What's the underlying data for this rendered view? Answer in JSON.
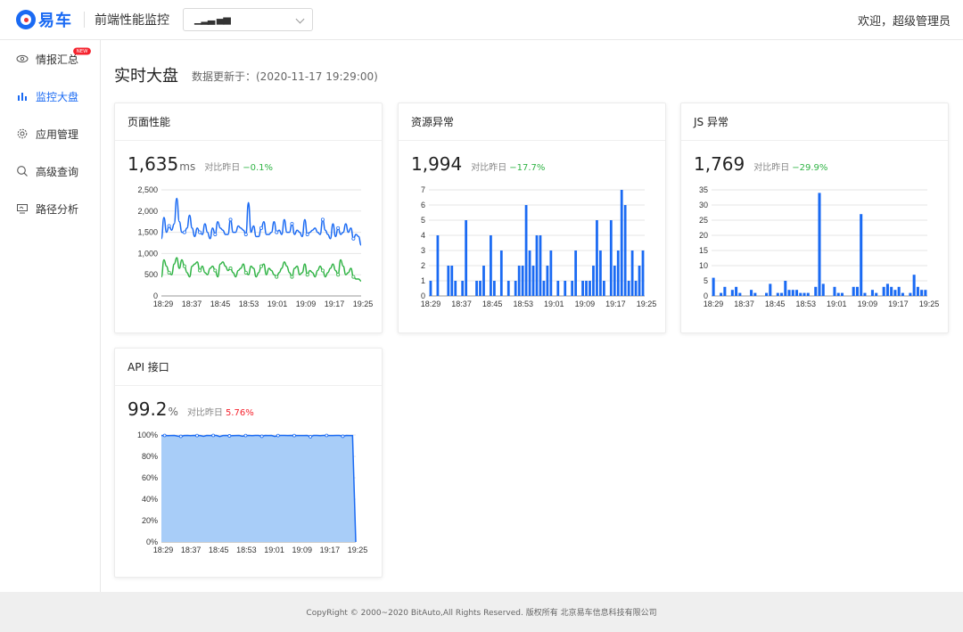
{
  "header": {
    "logo_text": "易车",
    "app_title": "前端性能监控",
    "project_select_value": "▁▂▃ ▄▅",
    "welcome": "欢迎，超级管理员"
  },
  "sidebar": {
    "items": [
      {
        "label": "情报汇总",
        "icon": "eye-icon",
        "badge": "NEW"
      },
      {
        "label": "监控大盘",
        "icon": "bar-chart-icon",
        "active": true
      },
      {
        "label": "应用管理",
        "icon": "gear-icon"
      },
      {
        "label": "高级查询",
        "icon": "search-icon"
      },
      {
        "label": "路径分析",
        "icon": "monitor-icon"
      }
    ]
  },
  "page": {
    "title": "实时大盘",
    "updated": "数据更新于：(2020-11-17 19:29:00)"
  },
  "cards": {
    "page_perf": {
      "title": "页面性能",
      "value": "1,635",
      "unit": "ms",
      "compare_label": "对比昨日",
      "delta": "−0.1%"
    },
    "resource": {
      "title": "资源异常",
      "value": "1,994",
      "compare_label": "对比昨日",
      "delta": "−17.7%"
    },
    "js": {
      "title": "JS 异常",
      "value": "1,769",
      "compare_label": "对比昨日",
      "delta": "−29.9%"
    },
    "api": {
      "title": "API 接口",
      "value": "99.2",
      "unit": "%",
      "compare_label": "对比昨日",
      "delta": "5.76%"
    }
  },
  "colors": {
    "accent": "#1a6af3",
    "green": "#2fb344",
    "red": "#f5222d",
    "area_fill": "#a8cdf8"
  },
  "chart_data": [
    {
      "type": "line",
      "ticks_x": [
        "18:29",
        "18:37",
        "18:45",
        "18:53",
        "19:01",
        "19:09",
        "19:17",
        "19:25"
      ],
      "ylim": [
        0,
        2500
      ],
      "yticks": [
        "0",
        "500",
        "1,000",
        "1,500",
        "2,000",
        "2,500"
      ],
      "series": [
        {
          "values": [
            1350,
            1850,
            1500,
            1650,
            1550,
            1700,
            2300,
            1750,
            1500,
            1500,
            1600,
            1900,
            1600,
            1400,
            1600,
            1500,
            1450,
            1700,
            1500,
            1350,
            1600,
            1450,
            1750,
            1600,
            1550,
            1450,
            1450,
            1800,
            1500,
            1500,
            1650,
            1600,
            1550,
            1450,
            2200,
            1500,
            1650,
            1400,
            1400,
            1600,
            1750,
            1450,
            1450,
            1500,
            1750,
            1500,
            1550,
            1450,
            1800,
            1500,
            1500,
            1700,
            1450,
            1550,
            1500,
            1400,
            1800,
            1450,
            1500,
            1550,
            1600,
            1500,
            1450,
            1800,
            1550,
            1450,
            1350,
            1700,
            1400,
            1600,
            1450,
            1500,
            1700,
            1500,
            1600,
            1350,
            1450,
            1400,
            1200
          ]
        },
        {
          "values": [
            450,
            850,
            700,
            550,
            500,
            750,
            900,
            650,
            850,
            700,
            550,
            450,
            700,
            750,
            800,
            600,
            700,
            550,
            500,
            650,
            700,
            600,
            450,
            750,
            800,
            700,
            600,
            650,
            550,
            450,
            600,
            650,
            750,
            550,
            500,
            700,
            650,
            450,
            550,
            700,
            750,
            500,
            650,
            600,
            500,
            450,
            550,
            650,
            800,
            700,
            550,
            450,
            650,
            700,
            500,
            550,
            750,
            500,
            600,
            550,
            450,
            600,
            700,
            600,
            450,
            550,
            650,
            750,
            600,
            500,
            850,
            700,
            500,
            550,
            650,
            450,
            400,
            400,
            350
          ]
        }
      ]
    },
    {
      "type": "bar",
      "ticks_x": [
        "18:29",
        "18:37",
        "18:45",
        "18:53",
        "19:01",
        "19:09",
        "19:17",
        "19:25"
      ],
      "ylim": [
        0,
        7
      ],
      "yticks": [
        "0",
        "1",
        "2",
        "3",
        "4",
        "5",
        "6",
        "7"
      ],
      "values": [
        1,
        0,
        4,
        0,
        0,
        2,
        2,
        1,
        0,
        1,
        5,
        0,
        0,
        1,
        1,
        2,
        0,
        4,
        1,
        0,
        3,
        0,
        1,
        0,
        1,
        2,
        2,
        6,
        3,
        2,
        4,
        4,
        1,
        2,
        3,
        0,
        1,
        0,
        1,
        0,
        1,
        3,
        0,
        1,
        1,
        1,
        2,
        5,
        3,
        1,
        0,
        5,
        2,
        3,
        7,
        6,
        1,
        3,
        1,
        2,
        3
      ],
      "xlabel": "",
      "ylabel": ""
    },
    {
      "type": "bar",
      "ticks_x": [
        "18:29",
        "18:37",
        "18:45",
        "18:53",
        "19:01",
        "19:09",
        "19:17",
        "19:25"
      ],
      "ylim": [
        0,
        35
      ],
      "yticks": [
        "0",
        "5",
        "10",
        "15",
        "20",
        "25",
        "30",
        "35"
      ],
      "values": [
        6,
        0,
        1,
        3,
        0,
        2,
        3,
        1,
        0,
        0,
        2,
        1,
        0,
        0,
        1,
        4,
        0,
        1,
        1,
        5,
        2,
        2,
        2,
        1,
        1,
        1,
        0,
        3,
        34,
        4,
        0,
        0,
        3,
        1,
        1,
        0,
        0,
        3,
        3,
        27,
        1,
        0,
        2,
        1,
        0,
        3,
        4,
        3,
        2,
        3,
        1,
        0,
        1,
        7,
        3,
        2,
        2
      ],
      "xlabel": "",
      "ylabel": ""
    },
    {
      "type": "area",
      "ticks_x": [
        "18:29",
        "18:37",
        "18:45",
        "18:53",
        "19:01",
        "19:09",
        "19:17",
        "19:25"
      ],
      "ylim": [
        0,
        100
      ],
      "yticks": [
        "0%",
        "20%",
        "40%",
        "60%",
        "80%",
        "100%"
      ],
      "values": [
        99.5,
        99.6,
        99.4,
        99.5,
        99.6,
        99.0,
        98.7,
        99.5,
        99.6,
        99.4,
        99.6,
        99.5,
        99.5,
        98.8,
        99.6,
        99.5,
        99.6,
        99.6,
        98.6,
        99.5,
        99.6,
        99.2,
        99.4,
        99.5,
        99.6,
        98.9,
        99.5,
        99.6,
        99.4,
        99.6,
        99.6,
        98.8,
        99.6,
        99.5,
        99.6,
        98.7,
        99.5,
        99.6,
        99.6,
        99.5,
        99.6,
        99.5,
        99.5,
        99.5,
        99.5,
        99.6,
        98.4,
        99.6,
        99.6,
        99.4,
        99.6,
        99.6,
        99.5,
        99.5,
        99.6,
        99.6,
        98.8,
        99.6,
        99.5,
        99.5,
        0
      ]
    }
  ],
  "footer": {
    "text": "CopyRight © 2000~2020 BitAuto,All Rights Reserved. 版权所有 北京易车信息科技有限公司"
  }
}
